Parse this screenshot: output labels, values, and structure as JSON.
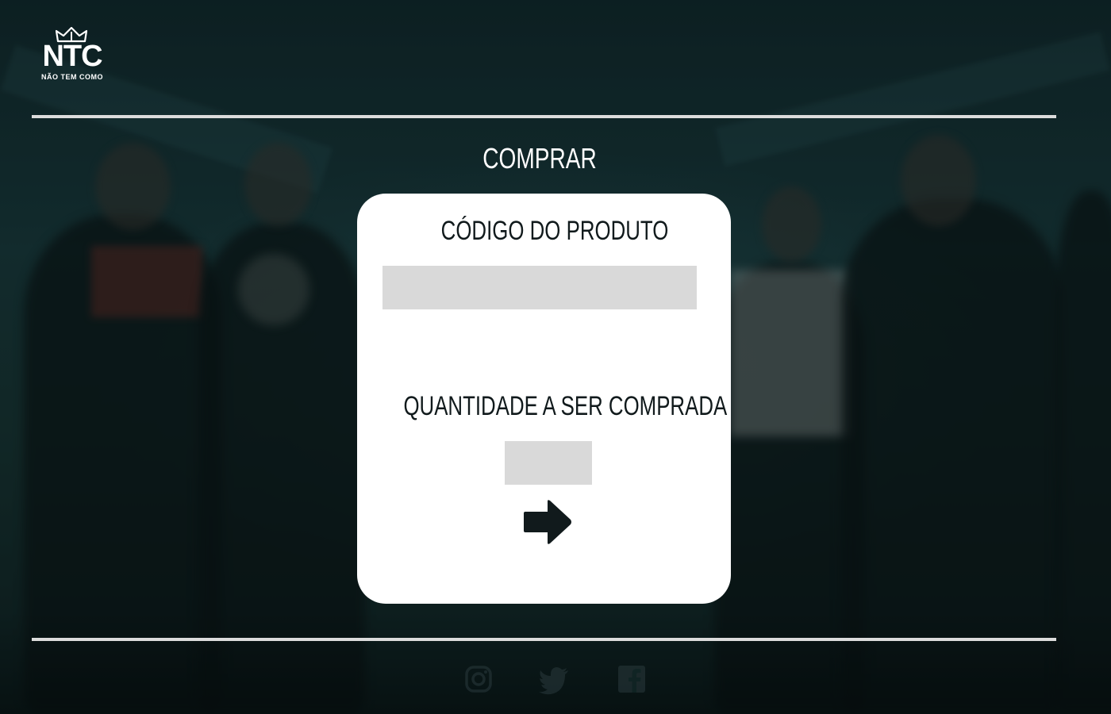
{
  "brand": {
    "logo_mark": "NTC",
    "logo_tagline": "NÃO TEM COMO"
  },
  "page": {
    "title": "COMPRAR"
  },
  "form": {
    "product_code_label": "CÓDIGO DO PRODUTO",
    "product_code_value": "",
    "quantity_label": "QUANTIDADE A SER COMPRADA",
    "quantity_value": "",
    "submit_icon": "arrow-right-icon"
  },
  "footer": {
    "social": [
      "instagram-icon",
      "twitter-icon",
      "facebook-icon"
    ]
  },
  "colors": {
    "card_background": "#ffffff",
    "input_background": "#d9d9d9",
    "text_dark": "#111a1c",
    "divider": "#dcdcdc",
    "page_background": "#16302f"
  }
}
